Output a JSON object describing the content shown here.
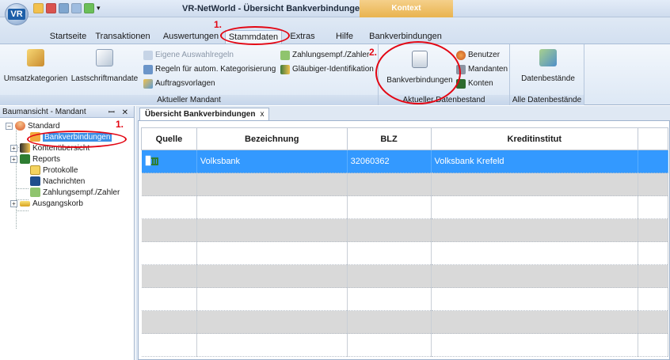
{
  "window": {
    "title": "VR-NetWorld - Übersicht Bankverbindungen",
    "context_tab": "Kontext",
    "logo_text": "VR"
  },
  "menu": {
    "tabs": [
      "Startseite",
      "Transaktionen",
      "Auswertungen",
      "Stammdaten",
      "Extras",
      "Hilfe",
      "Bankverbindungen"
    ],
    "active": "Stammdaten"
  },
  "ribbon": {
    "group1": {
      "label": "Aktueller Mandant",
      "big_buttons": [
        "Umsatzkategorien",
        "Lastschriftmandate"
      ],
      "small_buttons": [
        "Eigene Auswahlregeln",
        "Regeln für autom. Kategorisierung",
        "Auftragsvorlagen",
        "Zahlungsempf./Zahler",
        "Gläubiger-Identifikation"
      ]
    },
    "group2": {
      "label": "Aktueller Datenbestand",
      "big_button": "Bankverbindungen",
      "small_buttons": [
        "Benutzer",
        "Mandanten",
        "Konten"
      ]
    },
    "group3": {
      "label": "Alle Datenbestände",
      "big_button": "Datenbestände"
    }
  },
  "left_pane": {
    "title": "Baumansicht - Mandant",
    "controls": "ꟷ ✕",
    "tree": {
      "root": "Standard",
      "items": [
        "Bankverbindungen",
        "Kontenübersicht",
        "Reports",
        "Protokolle",
        "Nachrichten",
        "Zahlungsempf./Zahler",
        "Ausgangskorb"
      ]
    }
  },
  "document": {
    "tab_label": "Übersicht Bankverbindungen",
    "tab_close": "x",
    "columns": [
      "Quelle",
      "Bezeichnung",
      "BLZ",
      "Kreditinstitut",
      ""
    ],
    "rows": [
      {
        "quelle": "",
        "bezeichnung": "Volksbank",
        "blz": "32060362",
        "kreditinstitut": "Volksbank Krefeld"
      }
    ]
  },
  "annotations": {
    "step1": "1.",
    "step2": "2.",
    "color": "#e30613"
  }
}
